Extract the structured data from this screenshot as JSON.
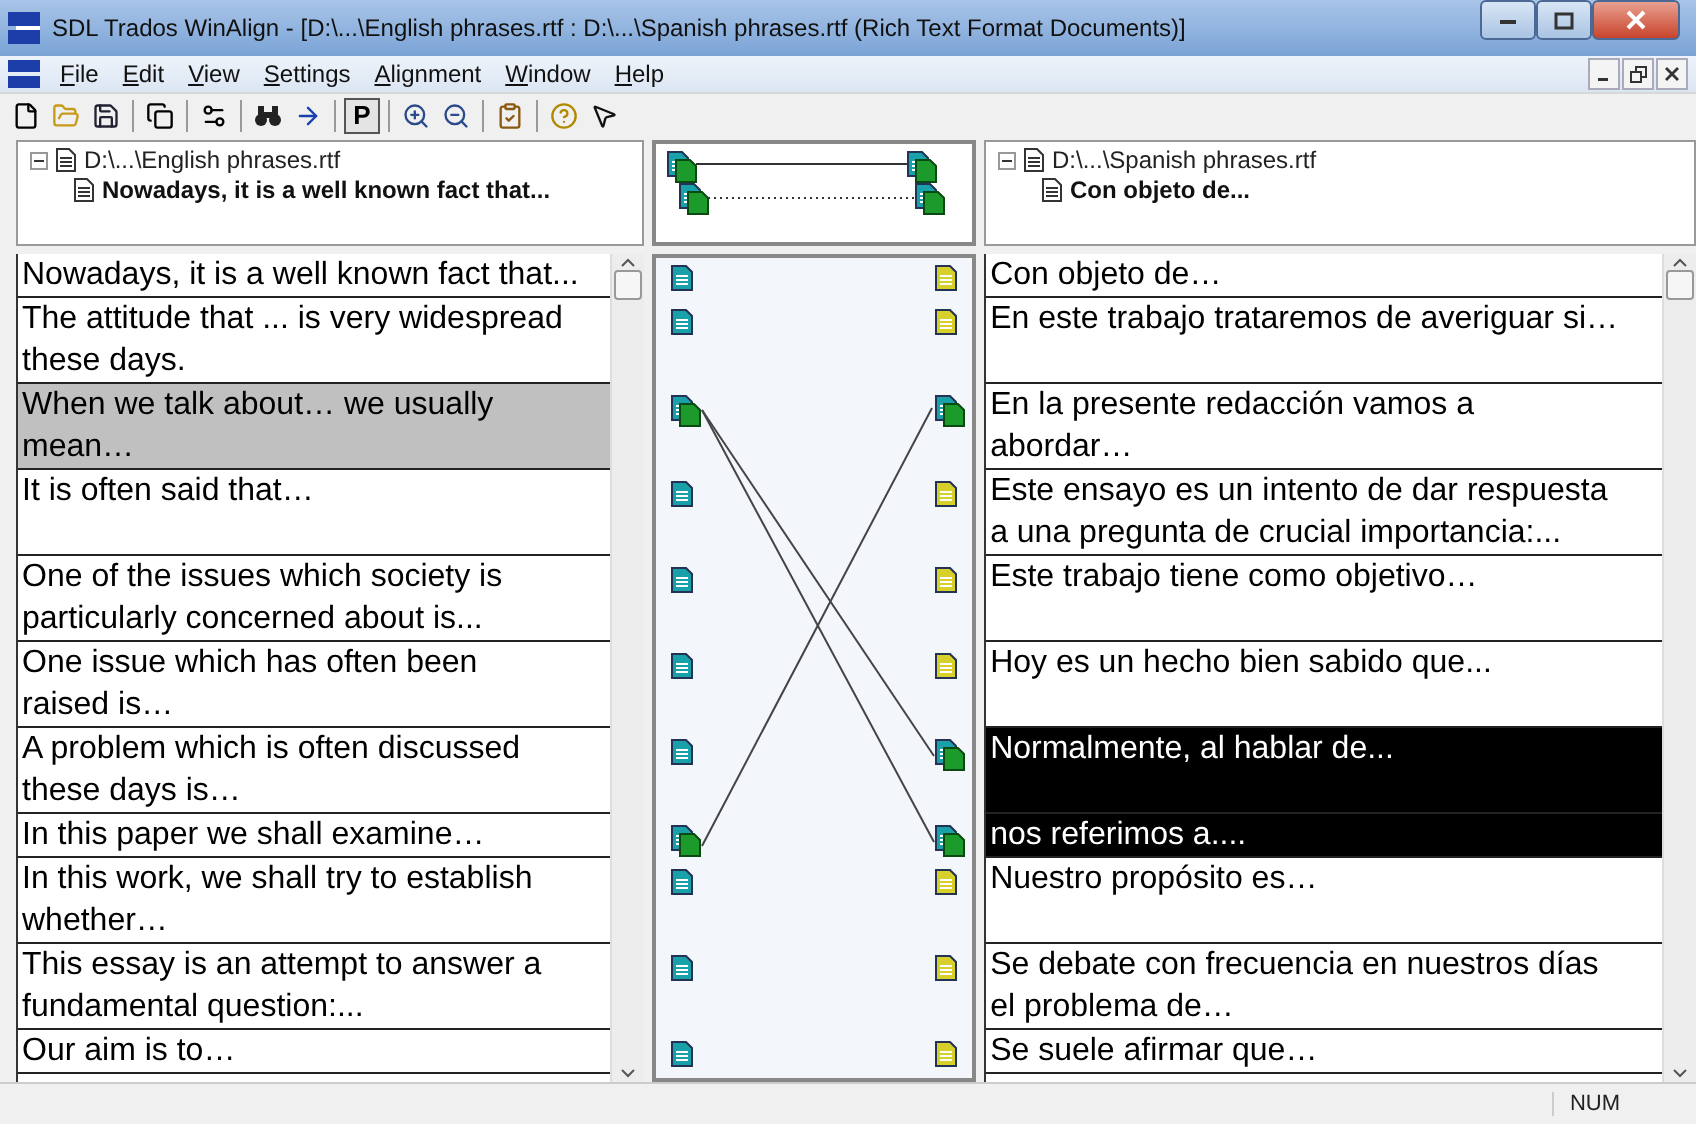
{
  "window": {
    "title": "SDL Trados WinAlign - [D:\\...\\English phrases.rtf : D:\\...\\Spanish phrases.rtf (Rich Text Format Documents)]"
  },
  "menu": [
    "File",
    "Edit",
    "View",
    "Settings",
    "Alignment",
    "Window",
    "Help"
  ],
  "toolbar": [
    {
      "kind": "new"
    },
    {
      "kind": "open"
    },
    {
      "kind": "save"
    },
    {
      "kind": "separator"
    },
    {
      "kind": "document"
    },
    {
      "kind": "separator"
    },
    {
      "kind": "properties"
    },
    {
      "kind": "separator"
    },
    {
      "kind": "find"
    },
    {
      "kind": "arrow"
    },
    {
      "kind": "separator"
    },
    {
      "kind": "text",
      "label": "P",
      "pressed": true
    },
    {
      "kind": "separator"
    },
    {
      "kind": "zoom-in"
    },
    {
      "kind": "zoom-out"
    },
    {
      "kind": "separator"
    },
    {
      "kind": "checklist"
    },
    {
      "kind": "separator"
    },
    {
      "kind": "help"
    },
    {
      "kind": "context-help"
    }
  ],
  "source_tree": {
    "file": "D:\\...\\English phrases.rtf",
    "segment": "Nowadays, it is a well known fact that..."
  },
  "target_tree": {
    "file": "D:\\...\\Spanish phrases.rtf",
    "segment": "Con objeto de..."
  },
  "source_pane": {
    "focused": false
  },
  "target_pane": {
    "focused": true
  },
  "rows": [
    {
      "left": {
        "lines": [
          "Nowadays, it is a well known fact that..."
        ],
        "selected": false,
        "linked": false
      },
      "right": {
        "lines": [
          "Con objeto de…"
        ],
        "selected": false,
        "linked": false
      }
    },
    {
      "left": {
        "lines": [
          "The attitude that ... is very widespread",
          "these days."
        ],
        "selected": false,
        "linked": false
      },
      "right": {
        "lines": [
          "En este trabajo trataremos de averiguar si…"
        ],
        "selected": false,
        "linked": false
      }
    },
    {
      "left": {
        "lines": [
          "When we talk about… we usually",
          "mean…"
        ],
        "selected": true,
        "linked": true
      },
      "right": {
        "lines": [
          "En la presente redacción vamos a",
          "abordar…"
        ],
        "selected": false,
        "linked": true
      }
    },
    {
      "left": {
        "lines": [
          "It is often said that…"
        ],
        "selected": false,
        "linked": false
      },
      "right": {
        "lines": [
          "Este ensayo es un intento de dar respuesta",
          "a una pregunta de crucial importancia:..."
        ],
        "selected": false,
        "linked": false
      }
    },
    {
      "left": {
        "lines": [
          "One of the issues which society is",
          "particularly concerned about is..."
        ],
        "selected": false,
        "linked": false
      },
      "right": {
        "lines": [
          "Este trabajo tiene como objetivo…"
        ],
        "selected": false,
        "linked": false
      }
    },
    {
      "left": {
        "lines": [
          "One issue which has often been",
          "raised is…"
        ],
        "selected": false,
        "linked": false
      },
      "right": {
        "lines": [
          "Hoy es un hecho bien sabido que..."
        ],
        "selected": false,
        "linked": false
      }
    },
    {
      "left": {
        "lines": [
          "A problem which is often discussed",
          "these days is…"
        ],
        "selected": false,
        "linked": false
      },
      "right": {
        "lines": [
          "Normalmente, al hablar de..."
        ],
        "selected": true,
        "linked": true
      }
    },
    {
      "left": {
        "lines": [
          "In this paper we shall examine…"
        ],
        "selected": false,
        "linked": true
      },
      "right": {
        "lines": [
          "nos referimos a...."
        ],
        "selected": true,
        "linked": true
      }
    },
    {
      "left": {
        "lines": [
          "In this work, we shall try to establish",
          "whether…"
        ],
        "selected": false,
        "linked": false
      },
      "right": {
        "lines": [
          "Nuestro propósito es…"
        ],
        "selected": false,
        "linked": false
      }
    },
    {
      "left": {
        "lines": [
          "This essay is an attempt to answer a",
          "fundamental question:..."
        ],
        "selected": false,
        "linked": false
      },
      "right": {
        "lines": [
          "Se debate con frecuencia en nuestros días",
          "el problema de…"
        ],
        "selected": false,
        "linked": false
      }
    },
    {
      "left": {
        "lines": [
          "Our aim is to…"
        ],
        "selected": false,
        "linked": false
      },
      "right": {
        "lines": [
          "Se suele afirmar que…"
        ],
        "selected": false,
        "linked": false
      }
    }
  ],
  "status_bar": {
    "num": "NUM"
  }
}
